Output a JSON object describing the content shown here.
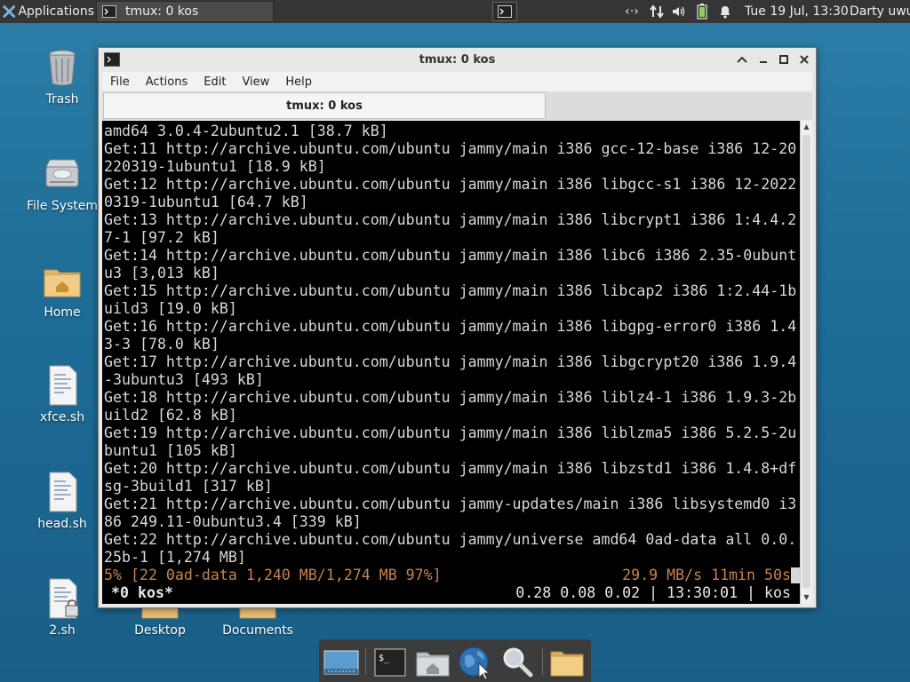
{
  "top_panel": {
    "apps_label": "Applications",
    "task_title": "tmux: 0 kos",
    "clock": "Tue 19 Jul, 13:30",
    "user": "Darty uwu"
  },
  "desktop": {
    "icons": [
      {
        "label": "Trash"
      },
      {
        "label": "File System"
      },
      {
        "label": "Home"
      },
      {
        "label": "xfce.sh"
      },
      {
        "label": "head.sh"
      },
      {
        "label": "2.sh"
      },
      {
        "label": "Desktop"
      },
      {
        "label": "Documents"
      }
    ]
  },
  "window": {
    "title": "tmux: 0 kos",
    "menu": [
      "File",
      "Actions",
      "Edit",
      "View",
      "Help"
    ],
    "tab_label": "tmux: 0 kos"
  },
  "terminal": {
    "lines": [
      "amd64 3.0.4-2ubuntu2.1 [38.7 kB]",
      "Get:11 http://archive.ubuntu.com/ubuntu jammy/main i386 gcc-12-base i386 12-20",
      "220319-1ubuntu1 [18.9 kB]",
      "Get:12 http://archive.ubuntu.com/ubuntu jammy/main i386 libgcc-s1 i386 12-2022",
      "0319-1ubuntu1 [64.7 kB]",
      "Get:13 http://archive.ubuntu.com/ubuntu jammy/main i386 libcrypt1 i386 1:4.4.2",
      "7-1 [97.2 kB]",
      "Get:14 http://archive.ubuntu.com/ubuntu jammy/main i386 libc6 i386 2.35-0ubunt",
      "u3 [3,013 kB]",
      "Get:15 http://archive.ubuntu.com/ubuntu jammy/main i386 libcap2 i386 1:2.44-1b",
      "uild3 [19.0 kB]",
      "Get:16 http://archive.ubuntu.com/ubuntu jammy/main i386 libgpg-error0 i386 1.4",
      "3-3 [78.0 kB]",
      "Get:17 http://archive.ubuntu.com/ubuntu jammy/main i386 libgcrypt20 i386 1.9.4",
      "-3ubuntu3 [493 kB]",
      "Get:18 http://archive.ubuntu.com/ubuntu jammy/main i386 liblz4-1 i386 1.9.3-2b",
      "uild2 [62.8 kB]",
      "Get:19 http://archive.ubuntu.com/ubuntu jammy/main i386 liblzma5 i386 5.2.5-2u",
      "buntu1 [105 kB]",
      "Get:20 http://archive.ubuntu.com/ubuntu jammy/main i386 libzstd1 i386 1.4.8+df",
      "sg-3build1 [317 kB]",
      "Get:21 http://archive.ubuntu.com/ubuntu jammy-updates/main i386 libsystemd0 i3",
      "86 249.11-0ubuntu3.4 [339 kB]",
      "Get:22 http://archive.ubuntu.com/ubuntu jammy/universe amd64 0ad-data all 0.0.",
      "25b-1 [1,274 MB]"
    ],
    "progress_left": "5% [22 0ad-data 1,240 MB/1,274 MB 97%]",
    "progress_right": "29.9 MB/s 11min 50s",
    "status_left": "*0 kos*",
    "status_right": "0.28 0.08 0.02 | 13:30:01 | kos"
  },
  "colors": {
    "progress_text": "#c8824f",
    "desktop_bg": "#1f6f99",
    "panel_bg": "#353535"
  }
}
